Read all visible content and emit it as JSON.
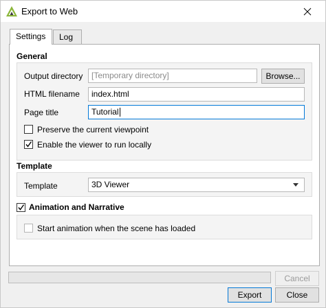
{
  "window": {
    "title": "Export to Web"
  },
  "tabs": [
    {
      "label": "Settings",
      "active": true
    },
    {
      "label": "Log",
      "active": false
    }
  ],
  "general": {
    "section_title": "General",
    "output_directory": {
      "label": "Output directory",
      "placeholder": "[Temporary directory]",
      "value": ""
    },
    "browse_label": "Browse...",
    "html_filename": {
      "label": "HTML filename",
      "value": "index.html"
    },
    "page_title": {
      "label": "Page title",
      "value": "Tutorial"
    },
    "preserve_viewpoint": {
      "label": "Preserve the current viewpoint",
      "checked": false
    },
    "run_locally": {
      "label": "Enable the viewer to run locally",
      "checked": true
    }
  },
  "template": {
    "section_title": "Template",
    "label": "Template",
    "selected": "3D Viewer"
  },
  "animation": {
    "section_title": "Animation and Narrative",
    "checked": true,
    "start_on_load": {
      "label": "Start animation when the scene has loaded",
      "checked": false,
      "enabled": false
    }
  },
  "progress": {
    "value": 0
  },
  "buttons": {
    "cancel": "Cancel",
    "export": "Export",
    "close": "Close"
  },
  "colors": {
    "accent": "#0078d7",
    "icon_green": "#8bb63a"
  }
}
